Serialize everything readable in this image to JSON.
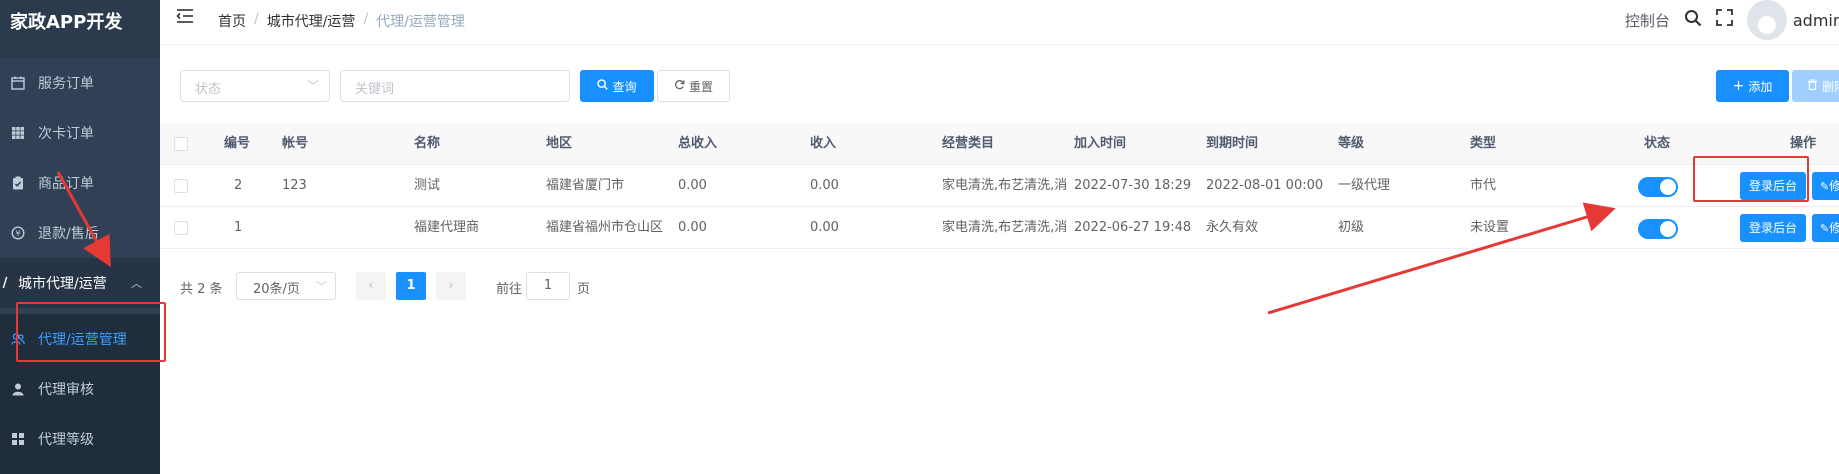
{
  "app": {
    "title": "家政APP开发"
  },
  "sidebar": {
    "items": [
      {
        "label": "服务订单",
        "icon": "calendar-icon"
      },
      {
        "label": "次卡订单",
        "icon": "grid-icon"
      },
      {
        "label": "商品订单",
        "icon": "clipboard-check-icon"
      },
      {
        "label": "退款/售后",
        "icon": "refund-icon"
      }
    ],
    "group": {
      "label": "城市代理/运营",
      "icon": "chevron-right-icon",
      "expanded": true
    },
    "subitems": [
      {
        "label": "代理/运营管理",
        "icon": "users-icon",
        "active": true
      },
      {
        "label": "代理审核",
        "icon": "user-icon"
      },
      {
        "label": "代理等级",
        "icon": "apps-icon"
      }
    ]
  },
  "header": {
    "breadcrumb": [
      "首页",
      "城市代理/运营",
      "代理/运营管理"
    ],
    "console_label": "控制台",
    "user_name": "admin"
  },
  "filter": {
    "status_placeholder": "状态",
    "keyword_placeholder": "关键词",
    "search_label": "查询",
    "reset_label": "重置",
    "add_label": "添加",
    "delete_label": "删除"
  },
  "table": {
    "columns": [
      "编号",
      "帐号",
      "名称",
      "地区",
      "总收入",
      "收入",
      "经营类目",
      "加入时间",
      "到期时间",
      "等级",
      "类型",
      "状态",
      "操作"
    ],
    "rows": [
      {
        "id": "2",
        "account": "123",
        "name": "测试",
        "region": "福建省厦门市",
        "total_income": "0.00",
        "income": "0.00",
        "category": "家电清洗,布艺清洗,消",
        "joined": "2022-07-30 18:29",
        "expires": "2022-08-01 00:00",
        "level": "一级代理",
        "type": "市代",
        "status_on": true,
        "login_label": "登录后台",
        "edit_label": "修"
      },
      {
        "id": "1",
        "account": "",
        "name": "福建代理商",
        "region": "福建省福州市仓山区",
        "total_income": "0.00",
        "income": "0.00",
        "category": "家电清洗,布艺清洗,消",
        "joined": "2022-06-27 19:48",
        "expires": "永久有效",
        "level": "初级",
        "type": "未设置",
        "status_on": true,
        "login_label": "登录后台",
        "edit_label": "修"
      }
    ]
  },
  "pagination": {
    "total_label": "共 2 条",
    "page_size": "20条/页",
    "current_page": "1",
    "goto_prefix": "前往",
    "goto_value": "1",
    "goto_suffix": "页"
  },
  "colors": {
    "primary": "#1890ff",
    "sidebar": "#304156",
    "annotation": "#e53935"
  }
}
